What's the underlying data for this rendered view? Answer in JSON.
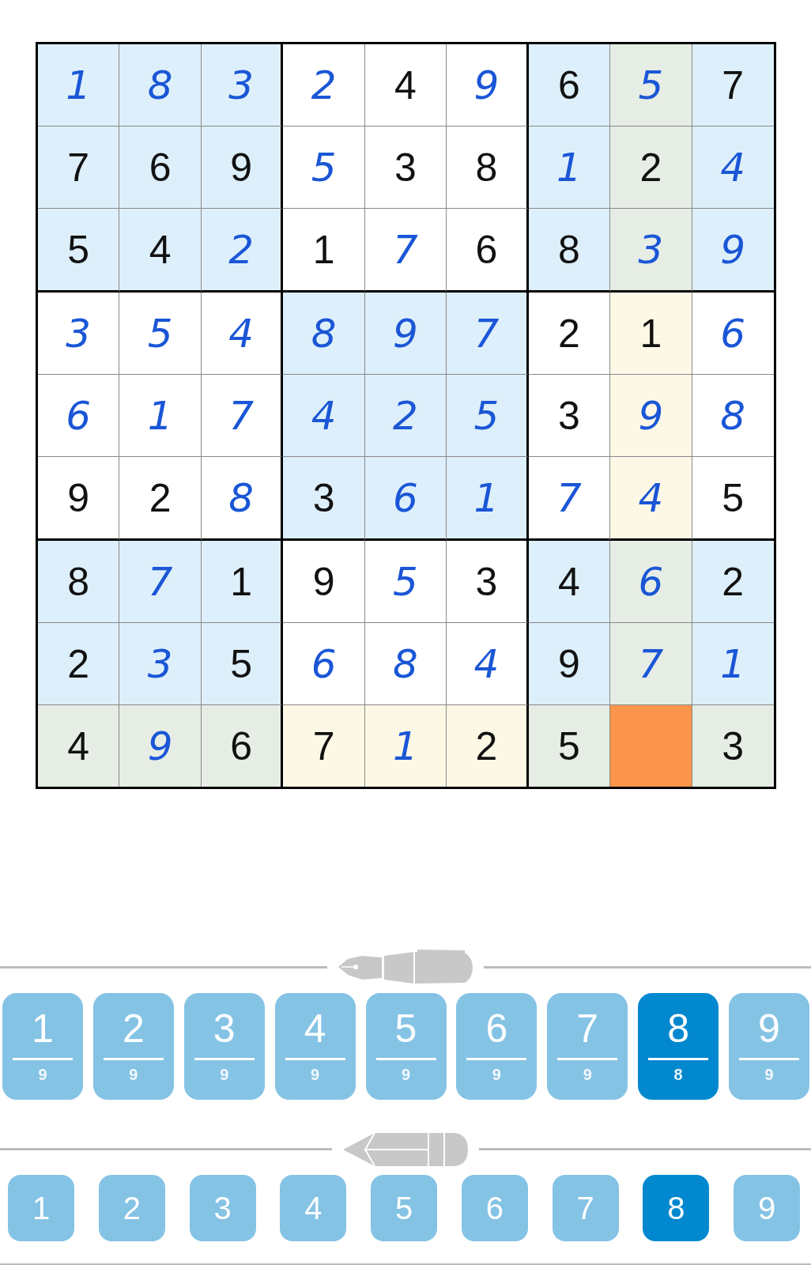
{
  "grid": [
    [
      {
        "value": "1",
        "kind": "entered",
        "selected": false,
        "highlighted": false
      },
      {
        "value": "8",
        "kind": "entered",
        "selected": false,
        "highlighted": false
      },
      {
        "value": "3",
        "kind": "entered",
        "selected": false,
        "highlighted": false
      },
      {
        "value": "2",
        "kind": "entered",
        "selected": false,
        "highlighted": false
      },
      {
        "value": "4",
        "kind": "given",
        "selected": false,
        "highlighted": false
      },
      {
        "value": "9",
        "kind": "entered",
        "selected": false,
        "highlighted": false
      },
      {
        "value": "6",
        "kind": "given",
        "selected": false,
        "highlighted": false
      },
      {
        "value": "5",
        "kind": "entered",
        "selected": false,
        "highlighted": true
      },
      {
        "value": "7",
        "kind": "given",
        "selected": false,
        "highlighted": false
      }
    ],
    [
      {
        "value": "7",
        "kind": "given",
        "selected": false,
        "highlighted": false
      },
      {
        "value": "6",
        "kind": "given",
        "selected": false,
        "highlighted": false
      },
      {
        "value": "9",
        "kind": "given",
        "selected": false,
        "highlighted": false
      },
      {
        "value": "5",
        "kind": "entered",
        "selected": false,
        "highlighted": false
      },
      {
        "value": "3",
        "kind": "given",
        "selected": false,
        "highlighted": false
      },
      {
        "value": "8",
        "kind": "given",
        "selected": false,
        "highlighted": false
      },
      {
        "value": "1",
        "kind": "entered",
        "selected": false,
        "highlighted": false
      },
      {
        "value": "2",
        "kind": "given",
        "selected": false,
        "highlighted": true
      },
      {
        "value": "4",
        "kind": "entered",
        "selected": false,
        "highlighted": false
      }
    ],
    [
      {
        "value": "5",
        "kind": "given",
        "selected": false,
        "highlighted": false
      },
      {
        "value": "4",
        "kind": "given",
        "selected": false,
        "highlighted": false
      },
      {
        "value": "2",
        "kind": "entered",
        "selected": false,
        "highlighted": false
      },
      {
        "value": "1",
        "kind": "given",
        "selected": false,
        "highlighted": false
      },
      {
        "value": "7",
        "kind": "entered",
        "selected": false,
        "highlighted": false
      },
      {
        "value": "6",
        "kind": "given",
        "selected": false,
        "highlighted": false
      },
      {
        "value": "8",
        "kind": "given",
        "selected": false,
        "highlighted": false
      },
      {
        "value": "3",
        "kind": "entered",
        "selected": false,
        "highlighted": true
      },
      {
        "value": "9",
        "kind": "entered",
        "selected": false,
        "highlighted": false
      }
    ],
    [
      {
        "value": "3",
        "kind": "entered",
        "selected": false,
        "highlighted": false
      },
      {
        "value": "5",
        "kind": "entered",
        "selected": false,
        "highlighted": false
      },
      {
        "value": "4",
        "kind": "entered",
        "selected": false,
        "highlighted": false
      },
      {
        "value": "8",
        "kind": "entered",
        "selected": false,
        "highlighted": false
      },
      {
        "value": "9",
        "kind": "entered",
        "selected": false,
        "highlighted": false
      },
      {
        "value": "7",
        "kind": "entered",
        "selected": false,
        "highlighted": false
      },
      {
        "value": "2",
        "kind": "given",
        "selected": false,
        "highlighted": false
      },
      {
        "value": "1",
        "kind": "given",
        "selected": false,
        "highlighted": true
      },
      {
        "value": "6",
        "kind": "entered",
        "selected": false,
        "highlighted": false
      }
    ],
    [
      {
        "value": "6",
        "kind": "entered",
        "selected": false,
        "highlighted": false
      },
      {
        "value": "1",
        "kind": "entered",
        "selected": false,
        "highlighted": false
      },
      {
        "value": "7",
        "kind": "entered",
        "selected": false,
        "highlighted": false
      },
      {
        "value": "4",
        "kind": "entered",
        "selected": false,
        "highlighted": false
      },
      {
        "value": "2",
        "kind": "entered",
        "selected": false,
        "highlighted": false
      },
      {
        "value": "5",
        "kind": "entered",
        "selected": false,
        "highlighted": false
      },
      {
        "value": "3",
        "kind": "given",
        "selected": false,
        "highlighted": false
      },
      {
        "value": "9",
        "kind": "entered",
        "selected": false,
        "highlighted": true
      },
      {
        "value": "8",
        "kind": "entered",
        "selected": false,
        "highlighted": false
      }
    ],
    [
      {
        "value": "9",
        "kind": "given",
        "selected": false,
        "highlighted": false
      },
      {
        "value": "2",
        "kind": "given",
        "selected": false,
        "highlighted": false
      },
      {
        "value": "8",
        "kind": "entered",
        "selected": false,
        "highlighted": false
      },
      {
        "value": "3",
        "kind": "given",
        "selected": false,
        "highlighted": false
      },
      {
        "value": "6",
        "kind": "entered",
        "selected": false,
        "highlighted": false
      },
      {
        "value": "1",
        "kind": "entered",
        "selected": false,
        "highlighted": false
      },
      {
        "value": "7",
        "kind": "entered",
        "selected": false,
        "highlighted": false
      },
      {
        "value": "4",
        "kind": "entered",
        "selected": false,
        "highlighted": true
      },
      {
        "value": "5",
        "kind": "given",
        "selected": false,
        "highlighted": false
      }
    ],
    [
      {
        "value": "8",
        "kind": "given",
        "selected": false,
        "highlighted": false
      },
      {
        "value": "7",
        "kind": "entered",
        "selected": false,
        "highlighted": false
      },
      {
        "value": "1",
        "kind": "given",
        "selected": false,
        "highlighted": false
      },
      {
        "value": "9",
        "kind": "given",
        "selected": false,
        "highlighted": false
      },
      {
        "value": "5",
        "kind": "entered",
        "selected": false,
        "highlighted": false
      },
      {
        "value": "3",
        "kind": "given",
        "selected": false,
        "highlighted": false
      },
      {
        "value": "4",
        "kind": "given",
        "selected": false,
        "highlighted": false
      },
      {
        "value": "6",
        "kind": "entered",
        "selected": false,
        "highlighted": true
      },
      {
        "value": "2",
        "kind": "given",
        "selected": false,
        "highlighted": false
      }
    ],
    [
      {
        "value": "2",
        "kind": "given",
        "selected": false,
        "highlighted": false
      },
      {
        "value": "3",
        "kind": "entered",
        "selected": false,
        "highlighted": false
      },
      {
        "value": "5",
        "kind": "given",
        "selected": false,
        "highlighted": false
      },
      {
        "value": "6",
        "kind": "entered",
        "selected": false,
        "highlighted": false
      },
      {
        "value": "8",
        "kind": "entered",
        "selected": false,
        "highlighted": false
      },
      {
        "value": "4",
        "kind": "entered",
        "selected": false,
        "highlighted": false
      },
      {
        "value": "9",
        "kind": "given",
        "selected": false,
        "highlighted": false
      },
      {
        "value": "7",
        "kind": "entered",
        "selected": false,
        "highlighted": true
      },
      {
        "value": "1",
        "kind": "entered",
        "selected": false,
        "highlighted": false
      }
    ],
    [
      {
        "value": "4",
        "kind": "given",
        "selected": false,
        "highlighted": true
      },
      {
        "value": "9",
        "kind": "entered",
        "selected": false,
        "highlighted": true
      },
      {
        "value": "6",
        "kind": "given",
        "selected": false,
        "highlighted": true
      },
      {
        "value": "7",
        "kind": "given",
        "selected": false,
        "highlighted": true
      },
      {
        "value": "1",
        "kind": "entered",
        "selected": false,
        "highlighted": true
      },
      {
        "value": "2",
        "kind": "given",
        "selected": false,
        "highlighted": true
      },
      {
        "value": "5",
        "kind": "given",
        "selected": false,
        "highlighted": true
      },
      {
        "kind": "empty",
        "selected": true
      },
      {
        "value": "3",
        "kind": "given",
        "selected": false,
        "highlighted": true
      }
    ]
  ],
  "pen_buttons": [
    {
      "digit": "1",
      "count": "9",
      "selected": false
    },
    {
      "digit": "2",
      "count": "9",
      "selected": false
    },
    {
      "digit": "3",
      "count": "9",
      "selected": false
    },
    {
      "digit": "4",
      "count": "9",
      "selected": false
    },
    {
      "digit": "5",
      "count": "9",
      "selected": false
    },
    {
      "digit": "6",
      "count": "9",
      "selected": false
    },
    {
      "digit": "7",
      "count": "9",
      "selected": false
    },
    {
      "digit": "8",
      "count": "8",
      "selected": true
    },
    {
      "digit": "9",
      "count": "9",
      "selected": false
    }
  ],
  "pencil_buttons": [
    {
      "digit": "1",
      "selected": false
    },
    {
      "digit": "2",
      "selected": false
    },
    {
      "digit": "3",
      "selected": false
    },
    {
      "digit": "4",
      "selected": false
    },
    {
      "digit": "5",
      "selected": false
    },
    {
      "digit": "6",
      "selected": false
    },
    {
      "digit": "7",
      "selected": false
    },
    {
      "digit": "8",
      "selected": true
    },
    {
      "digit": "9",
      "selected": false
    }
  ]
}
